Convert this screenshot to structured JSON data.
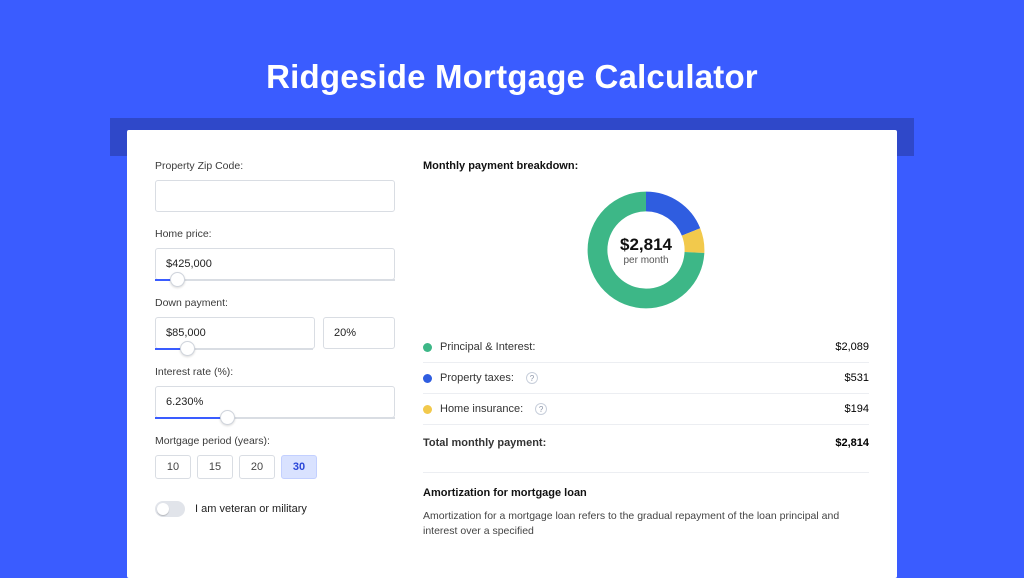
{
  "title": "Ridgeside Mortgage Calculator",
  "form": {
    "zip_label": "Property Zip Code:",
    "zip_value": "",
    "home_price_label": "Home price:",
    "home_price_value": "$425,000",
    "home_price_slider_pct": 9,
    "down_payment_label": "Down payment:",
    "down_payment_value": "$85,000",
    "down_payment_pct_value": "20%",
    "down_payment_slider_pct": 20,
    "interest_label": "Interest rate (%):",
    "interest_value": "6.230%",
    "interest_slider_pct": 30,
    "period_label": "Mortgage period (years):",
    "periods": [
      "10",
      "15",
      "20",
      "30"
    ],
    "period_selected": "30",
    "veteran_label": "I am veteran or military"
  },
  "breakdown": {
    "title": "Monthly payment breakdown:",
    "center_value": "$2,814",
    "center_sub": "per month",
    "items": [
      {
        "label": "Principal & Interest:",
        "value": "$2,089",
        "color": "#3db787",
        "help": false,
        "share": 0.742
      },
      {
        "label": "Property taxes:",
        "value": "$531",
        "color": "#2f5de0",
        "help": true,
        "share": 0.189
      },
      {
        "label": "Home insurance:",
        "value": "$194",
        "color": "#f2c94c",
        "help": true,
        "share": 0.069
      }
    ],
    "total_label": "Total monthly payment:",
    "total_value": "$2,814"
  },
  "amort": {
    "title": "Amortization for mortgage loan",
    "text": "Amortization for a mortgage loan refers to the gradual repayment of the loan principal and interest over a specified"
  },
  "chart_data": {
    "type": "pie",
    "title": "Monthly payment breakdown",
    "total": 2814,
    "series": [
      {
        "name": "Principal & Interest",
        "value": 2089,
        "color": "#3db787"
      },
      {
        "name": "Property taxes",
        "value": 531,
        "color": "#2f5de0"
      },
      {
        "name": "Home insurance",
        "value": 194,
        "color": "#f2c94c"
      }
    ]
  }
}
